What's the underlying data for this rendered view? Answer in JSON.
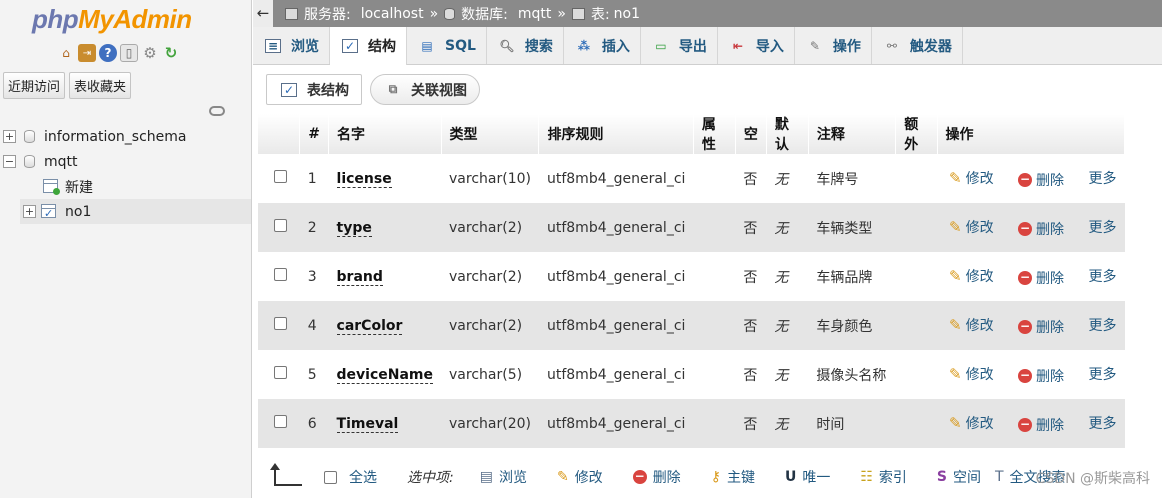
{
  "left": {
    "logo_php": "php",
    "logo_myadmin": "MyAdmin",
    "recent_btn": "近期访问",
    "favorites_btn": "表收藏夹",
    "tree": {
      "db1": "information_schema",
      "db2": "mqtt",
      "new_item": "新建",
      "table1": "no1"
    }
  },
  "crumb": {
    "server_label": "服务器:",
    "server_value": "localhost",
    "db_label": "数据库:",
    "db_value": "mqtt",
    "table_label": "表:",
    "table_value": "no1"
  },
  "tabs": [
    "浏览",
    "结构",
    "SQL",
    "搜索",
    "插入",
    "导出",
    "导入",
    "操作",
    "触发器"
  ],
  "subtabs": {
    "structure": "表结构",
    "relation": "关联视图"
  },
  "columns": [
    "#",
    "名字",
    "类型",
    "排序规则",
    "属性",
    "空",
    "默认",
    "注释",
    "额外",
    "操作"
  ],
  "rows": [
    {
      "num": "1",
      "name": "license",
      "type": "varchar(10)",
      "collation": "utf8mb4_general_ci",
      "null": "否",
      "default": "无",
      "comment": "车牌号"
    },
    {
      "num": "2",
      "name": "type",
      "type": "varchar(2)",
      "collation": "utf8mb4_general_ci",
      "null": "否",
      "default": "无",
      "comment": "车辆类型"
    },
    {
      "num": "3",
      "name": "brand",
      "type": "varchar(2)",
      "collation": "utf8mb4_general_ci",
      "null": "否",
      "default": "无",
      "comment": "车辆品牌"
    },
    {
      "num": "4",
      "name": "carColor",
      "type": "varchar(2)",
      "collation": "utf8mb4_general_ci",
      "null": "否",
      "default": "无",
      "comment": "车身颜色"
    },
    {
      "num": "5",
      "name": "deviceName",
      "type": "varchar(5)",
      "collation": "utf8mb4_general_ci",
      "null": "否",
      "default": "无",
      "comment": "摄像头名称"
    },
    {
      "num": "6",
      "name": "Timeval",
      "type": "varchar(20)",
      "collation": "utf8mb4_general_ci",
      "null": "否",
      "default": "无",
      "comment": "时间"
    }
  ],
  "row_actions": {
    "edit": "修改",
    "delete": "删除",
    "more": "更多"
  },
  "bottom": {
    "select_all": "全选",
    "selected_label": "选中项:",
    "browse": "浏览",
    "edit": "修改",
    "delete": "删除",
    "primary": "主键",
    "unique": "唯一",
    "index": "索引",
    "spatial": "空间",
    "fulltext": "全文搜索"
  },
  "watermark": "CSDN @斯柴高科"
}
